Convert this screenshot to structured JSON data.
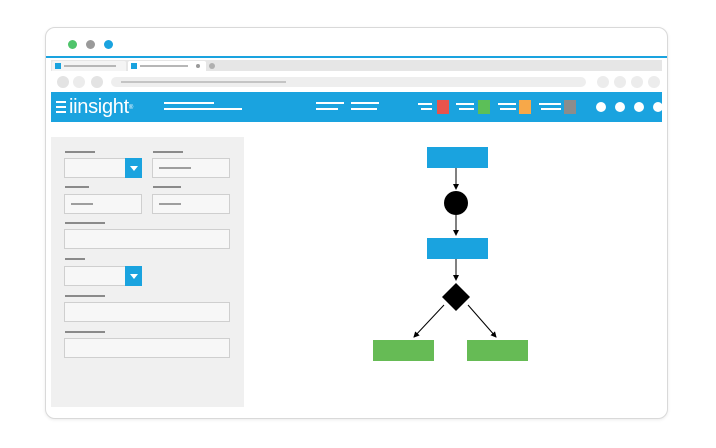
{
  "colors": {
    "brand": "#1aa3df",
    "dot_green": "#4fc46b",
    "dot_gray": "#9a9a9a",
    "dot_blue": "#1aa3df",
    "swatch_red": "#e8544d",
    "swatch_green": "#5cbf58",
    "swatch_orange": "#f7a849",
    "swatch_gray": "#8c8c8c",
    "flow_blue": "#1aa3df",
    "flow_green": "#66bb55",
    "flow_dark": "#000000"
  },
  "app": {
    "logo_text": "iinsight",
    "logo_mark": "®"
  },
  "icons": {
    "menu": "hamburger-icon"
  }
}
